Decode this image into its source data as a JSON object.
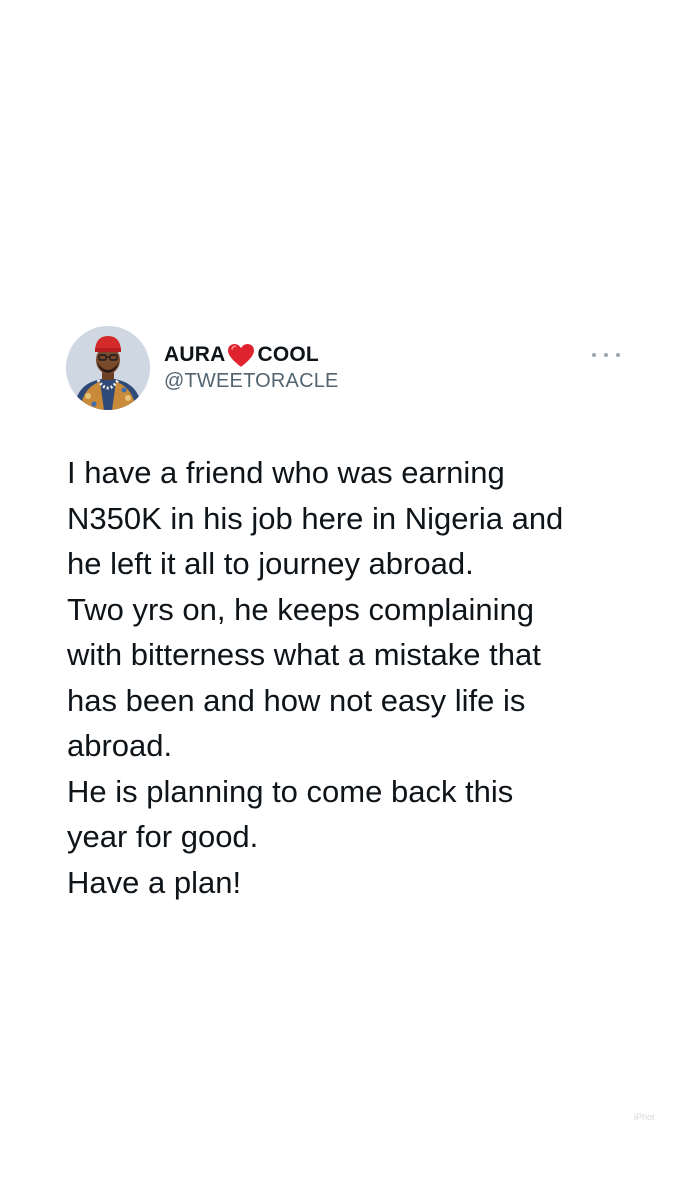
{
  "author": {
    "name_left": "AURA",
    "name_right": "COOL",
    "name_emoji": "red-heart-icon",
    "handle": "@TWEETORACLE",
    "avatar": "profile-photo"
  },
  "menu": {
    "icon": "more-horizontal-icon"
  },
  "tweet": {
    "lines": [
      "I have a friend who was earning",
      "N350K in his job here in Nigeria and",
      "he left it all to journey abroad.",
      "Two yrs on, he keeps complaining",
      "with bitterness what a mistake that",
      "has been and how not easy life is",
      "abroad.",
      "He is planning to come back this",
      "year for good.",
      "Have a plan!"
    ]
  },
  "watermark": {
    "text": "iPhot"
  },
  "colors": {
    "background": "#ffffff",
    "text_primary": "#0f1419",
    "text_secondary": "#536471",
    "heart": "#e0242f"
  }
}
